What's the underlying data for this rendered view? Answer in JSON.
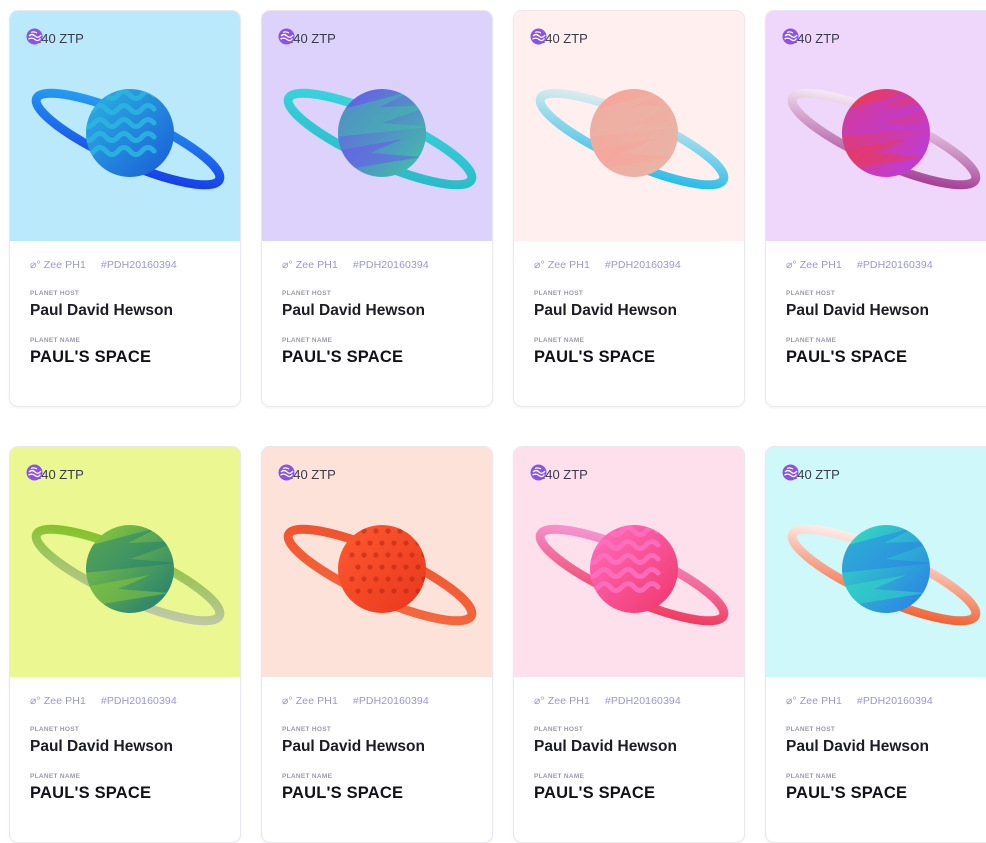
{
  "labels": {
    "planet_host": "PLANET HOST",
    "planet_name": "PLANET NAME"
  },
  "cards": [
    {
      "price": "140 ZTP",
      "zee": "Zee PH1",
      "code": "#PDH20160394",
      "host": "Paul David Hewson",
      "name": "PAUL'S SPACE",
      "bg": "#b9e9fb",
      "planet_c1": "#2bb4e0",
      "planet_c2": "#1a5bd8",
      "ring_c1": "#27a7f5",
      "ring_c2": "#1633e6",
      "pattern": "waves",
      "icon": "planet-icon"
    },
    {
      "price": "140 ZTP",
      "zee": "Zee PH1",
      "code": "#PDH20160394",
      "host": "Paul David Hewson",
      "name": "PAUL'S SPACE",
      "bg": "#dcd2fb",
      "planet_c1": "#6b52f0",
      "planet_c2": "#3cc9a0",
      "ring_c1": "#3ad6e0",
      "ring_c2": "#27b8c6",
      "pattern": "flames",
      "icon": "planet-icon"
    },
    {
      "price": "140 ZTP",
      "zee": "Zee PH1",
      "code": "#PDH20160394",
      "host": "Paul David Hewson",
      "name": "PAUL'S SPACE",
      "bg": "#fff0ef",
      "planet_c1": "#f9a39a",
      "planet_c2": "#e6b7a8",
      "ring_c1": "#f2f2ee",
      "ring_c2": "#12b7e8",
      "pattern": "flames",
      "icon": "planet-icon"
    },
    {
      "price": "140 ZTP",
      "zee": "Zee PH1",
      "code": "#PDH20160394",
      "host": "Paul David Hewson",
      "name": "PAUL'S SPACE",
      "bg": "#efd6fb",
      "planet_c1": "#f03a4a",
      "planet_c2": "#b43cf0",
      "ring_c1": "#ffffff",
      "ring_c2": "#9a2a8a",
      "pattern": "flames",
      "icon": "planet-icon"
    },
    {
      "price": "140 ZTP",
      "zee": "Zee PH1",
      "code": "#PDH20160394",
      "host": "Paul David Hewson",
      "name": "PAUL'S SPACE",
      "bg": "#ebf791",
      "planet_c1": "#8ccc3a",
      "planet_c2": "#1c7a74",
      "ring_c1": "#7cc21a",
      "ring_c2": "#c9c9b8",
      "pattern": "flames",
      "icon": "planet-icon"
    },
    {
      "price": "140 ZTP",
      "zee": "Zee PH1",
      "code": "#PDH20160394",
      "host": "Paul David Hewson",
      "name": "PAUL'S SPACE",
      "bg": "#fde2da",
      "planet_c1": "#ff5a30",
      "planet_c2": "#e8361e",
      "ring_c1": "#f0502c",
      "ring_c2": "#f56a40",
      "pattern": "dots",
      "icon": "planet-icon"
    },
    {
      "price": "140 ZTP",
      "zee": "Zee PH1",
      "code": "#PDH20160394",
      "host": "Paul David Hewson",
      "name": "PAUL'S SPACE",
      "bg": "#fde0ec",
      "planet_c1": "#ff6fbf",
      "planet_c2": "#f0356a",
      "ring_c1": "#f5a0e0",
      "ring_c2": "#f03050",
      "pattern": "waves",
      "icon": "planet-icon"
    },
    {
      "price": "140 ZTP",
      "zee": "Zee PH1",
      "code": "#PDH20160394",
      "host": "Paul David Hewson",
      "name": "PAUL'S SPACE",
      "bg": "#cff8fb",
      "planet_c1": "#33e0c0",
      "planet_c2": "#2a7ae8",
      "ring_c1": "#ffffff",
      "ring_c2": "#f0501e",
      "pattern": "flames",
      "icon": "planet-icon"
    }
  ]
}
